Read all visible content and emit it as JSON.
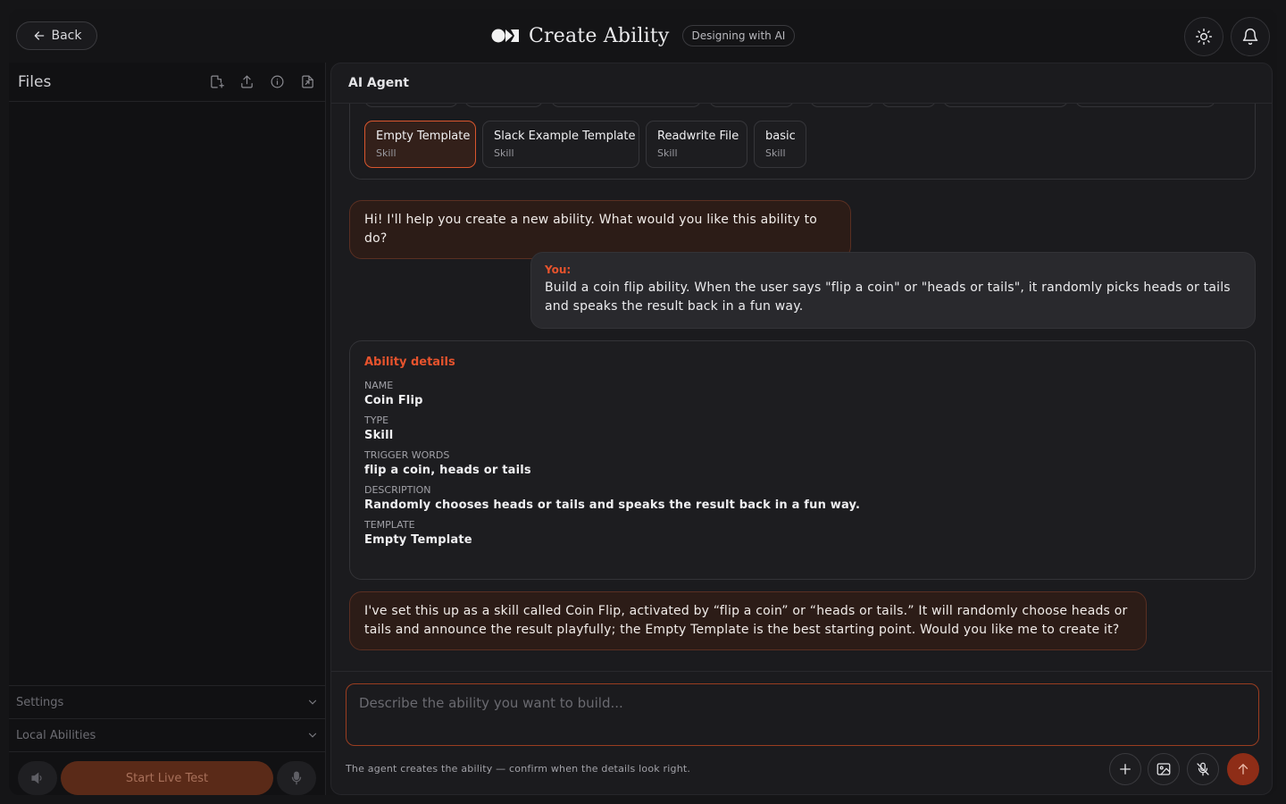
{
  "header": {
    "back_label": "Back",
    "title": "Create Ability",
    "badge": "Designing with AI",
    "icons": [
      "sun-icon",
      "bell-icon"
    ]
  },
  "files": {
    "title": "Files",
    "tools": [
      "new-file-icon",
      "upload-icon",
      "info-icon",
      "export-icon"
    ]
  },
  "sidebar_sections": {
    "settings": "Settings",
    "local_abilities": "Local Abilities"
  },
  "live": {
    "start_label": "Start Live Test"
  },
  "agent": {
    "title": "AI Agent"
  },
  "templates": [
    {
      "name": "Empty Template",
      "type": "Skill",
      "selected": true
    },
    {
      "name": "Slack Example Template",
      "type": "Skill",
      "selected": false
    },
    {
      "name": "Readwrite File",
      "type": "Skill",
      "selected": false
    },
    {
      "name": "basic",
      "type": "Skill",
      "selected": false
    }
  ],
  "messages": {
    "ai_greeting": "Hi! I'll help you create a new ability. What would you like this ability to do?",
    "user_label": "You:",
    "user_text": "Build a coin flip ability. When the user says \"flip a coin\" or \"heads or tails\", it randomly picks heads or tails and speaks the result back in a fun way.",
    "ai_followup": "I've set this up as a skill called Coin Flip, activated by “flip a coin” or “heads or tails.” It will randomly choose heads or tails and announce the result playfully; the Empty Template is the best starting point. Would you like me to create it?"
  },
  "details": {
    "title": "Ability details",
    "fields": [
      {
        "label": "NAME",
        "value": "Coin Flip"
      },
      {
        "label": "TYPE",
        "value": "Skill"
      },
      {
        "label": "TRIGGER WORDS",
        "value": "flip a coin, heads or tails"
      },
      {
        "label": "DESCRIPTION",
        "value": "Randomly chooses heads or tails and speaks the result back in a fun way."
      },
      {
        "label": "TEMPLATE",
        "value": "Empty Template"
      }
    ]
  },
  "composer": {
    "placeholder": "Describe the ability you want to build...",
    "hint": "The agent creates the ability — confirm when the details look right."
  },
  "colors": {
    "accent": "#e6532d",
    "ai_bubble": "#2c1c17",
    "user_bubble": "#29292d",
    "send_button": "#8e2d17"
  }
}
